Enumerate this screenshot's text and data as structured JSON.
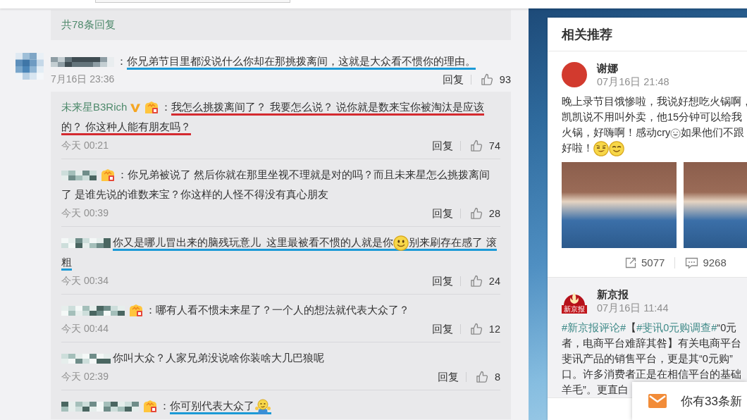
{
  "replies_summary": "共78条回复",
  "comment": {
    "avatar": {
      "kind": "pixelated"
    },
    "author_hidden": true,
    "verified": false,
    "badge": false,
    "colon": "：",
    "lines": [
      [
        {
          "kind": "text",
          "text": "你兄弟节目里都没说什么你却在那挑拨离间，这就是大众看不惯你的理由。"
        }
      ]
    ],
    "underline": {
      "color": "#1b9ad6"
    },
    "time": "7月16日 23:36",
    "reply_label": "回复",
    "likes": "93",
    "replies": [
      {
        "author_hidden": false,
        "author": "未来星B3Rich",
        "verified": true,
        "badge": true,
        "colon": "：",
        "lines": [
          [
            {
              "kind": "text",
              "text": "我怎么挑拨离间了？ 我要怎么说？ 说你就是数来宝你被淘汰是应该"
            }
          ],
          [
            {
              "kind": "text",
              "text": "的？ 你这种人能有朋友吗？"
            }
          ]
        ],
        "underline": {
          "color": "#d42a2f"
        },
        "time": "今天 00:21",
        "reply_label": "回复",
        "likes": "74"
      },
      {
        "author_hidden": true,
        "verified": false,
        "badge": true,
        "colon": "：",
        "lines": [
          [
            {
              "kind": "text",
              "text": "你兄弟被说了 然后你就在那里坐视不理就是对的吗？而且未来星怎么挑拨离间"
            }
          ],
          [
            {
              "kind": "text",
              "text": "了 是谁先说的谁数来宝？你这样的人怪不得没有真心朋友"
            }
          ]
        ],
        "time": "今天 00:39",
        "reply_label": "回复",
        "likes": "28"
      },
      {
        "author_hidden": true,
        "verified": false,
        "badge": false,
        "lines": [
          [
            {
              "kind": "text",
              "text": "你又是哪儿冒出来的脑残玩意儿  这里最被看不惯的人就是你"
            },
            {
              "kind": "smile"
            },
            {
              "kind": "text",
              "text": "别来刷存在感了 滚"
            }
          ],
          [
            {
              "kind": "text",
              "text": "粗"
            }
          ]
        ],
        "underline": {
          "color": "#1b9ad6"
        },
        "time": "今天 00:34",
        "reply_label": "回复",
        "likes": "24"
      },
      {
        "author_hidden": true,
        "verified": false,
        "badge": true,
        "colon": "：",
        "lines": [
          [
            {
              "kind": "text",
              "text": "哪有人看不惯未来星了？一个人的想法就代表大众了？"
            }
          ]
        ],
        "time": "今天 00:44",
        "reply_label": "回复",
        "likes": "12"
      },
      {
        "author_hidden": true,
        "verified": false,
        "badge": false,
        "lines": [
          [
            {
              "kind": "text",
              "text": "你叫大众？人家兄弟没说啥你装啥大几巴狼呢"
            }
          ]
        ],
        "time": "今天 02:39",
        "reply_label": "回复",
        "likes": "8"
      },
      {
        "author_hidden": true,
        "verified": false,
        "badge": true,
        "colon": "：",
        "lines": [
          [
            {
              "kind": "text",
              "text": "你可别代表大众了"
            },
            {
              "kind": "shrug"
            }
          ]
        ],
        "underline": {
          "color": "#1b9ad6"
        }
      }
    ]
  },
  "recommendations": {
    "title": "相关推荐",
    "posts": [
      {
        "highlighted": false,
        "avatar": {
          "kind": "photo"
        },
        "author": "谢娜",
        "time": "07月16日 21:48",
        "kind": "photo",
        "lines": [
          [
            {
              "kind": "text",
              "text": "晚上录节目饿惨啦，我说好想吃火锅啊，"
            }
          ],
          [
            {
              "kind": "text",
              "text": "凯凯说不用叫外卖，他15分钟可以给我"
            }
          ],
          [
            {
              "kind": "text",
              "text": "火锅，好嗨啊！感动cry"
            },
            {
              "kind": "laugh"
            },
            {
              "kind": "text",
              "text": "如果他们不跟"
            }
          ],
          [
            {
              "kind": "text",
              "text": "好啦！"
            },
            {
              "kind": "smirk"
            },
            {
              "kind": "grin"
            }
          ]
        ],
        "stats": [
          {
            "kind": "share",
            "count": "5077"
          },
          {
            "kind": "comment",
            "count": "9268"
          }
        ]
      },
      {
        "highlighted": true,
        "avatar": {
          "kind": "logo",
          "text": "新京报"
        },
        "author": "新京报",
        "time": "07月16日 11:44",
        "kind": "text",
        "lines": [
          [
            {
              "kind": "tag",
              "text": "#新京报评论#"
            },
            {
              "kind": "text",
              "text": "【"
            },
            {
              "kind": "tag",
              "text": "#斐讯0元购调查#"
            },
            {
              "kind": "text",
              "text": "“0元"
            }
          ],
          [
            {
              "kind": "text",
              "text": "者，电商平台难辞其咎】有关电商平台"
            }
          ],
          [
            {
              "kind": "text",
              "text": "斐讯产品的销售平台，更是其“0元购”"
            }
          ],
          [
            {
              "kind": "text",
              "text": "口。许多消费者正是在相信平台的基础"
            }
          ],
          [
            {
              "kind": "text",
              "text": "羊毛”。更直白"
            }
          ]
        ]
      }
    ]
  },
  "notification": {
    "text": "你有33条新"
  }
}
